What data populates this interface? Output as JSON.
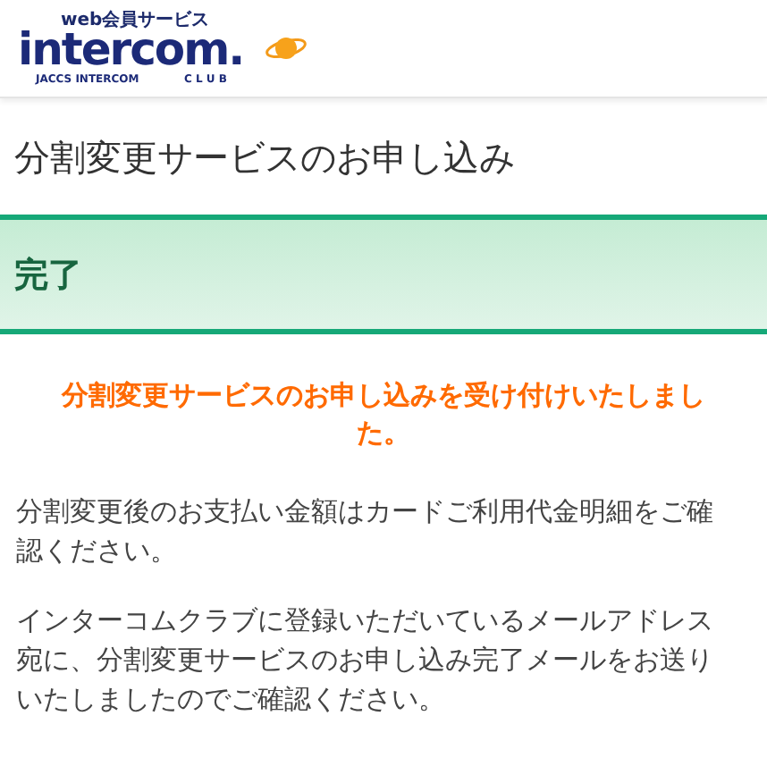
{
  "logo": {
    "tagline": "web会員サービス",
    "wordmark": "intercom.",
    "subline": "JACCS INTERCOM",
    "club": "C L U B"
  },
  "page_title": "分割変更サービスのお申し込み",
  "status_banner": "完了",
  "notice": "分割変更サービスのお申し込みを受け付けいたしました。",
  "paragraphs": [
    "分割変更後のお支払い金額はカードご利用代金明細をご確認ください。",
    "インターコムクラブに登録いただいているメールアドレス宛に、分割変更サービスのお申し込み完了メールをお送りいたしましたのでご確認ください。"
  ]
}
